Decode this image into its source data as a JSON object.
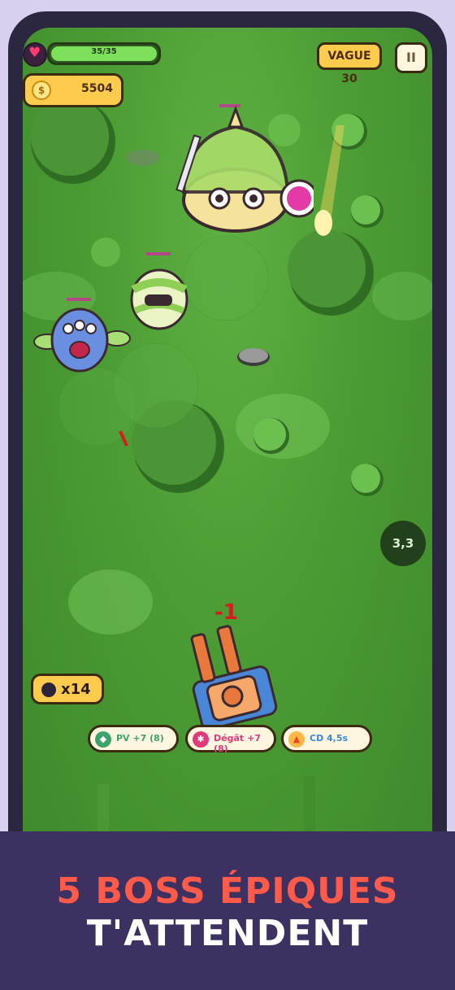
{
  "hud": {
    "health_text": "35/35",
    "health_fraction": 1.0,
    "wave_label": "VAGUE 30",
    "pause_symbol": "II",
    "coin_count": "5504",
    "coin_symbol": "$",
    "bomb_count": "x14",
    "cooldown_value": "3,3",
    "damage_popup": "-1"
  },
  "upgrades": [
    {
      "label": "PV +7 (8)",
      "icon": "shield-icon",
      "color": "#3ea36b"
    },
    {
      "label": "Dégât +7 (8)",
      "icon": "damage-orb-icon",
      "color": "#e03a7a"
    },
    {
      "label": "CD 4,5s",
      "icon": "flame-icon",
      "color": "#3a88d6"
    }
  ],
  "banner": {
    "line1": "5 BOSS ÉPIQUES",
    "line2": "T'ATTENDENT"
  },
  "colors": {
    "background": "#d9cfee",
    "phone_frame": "#2b2741",
    "grass": "#4c9c34",
    "banner_bg": "#3c3160",
    "banner_accent": "#ff5a4a",
    "hud_gold": "#ffcb4c"
  }
}
